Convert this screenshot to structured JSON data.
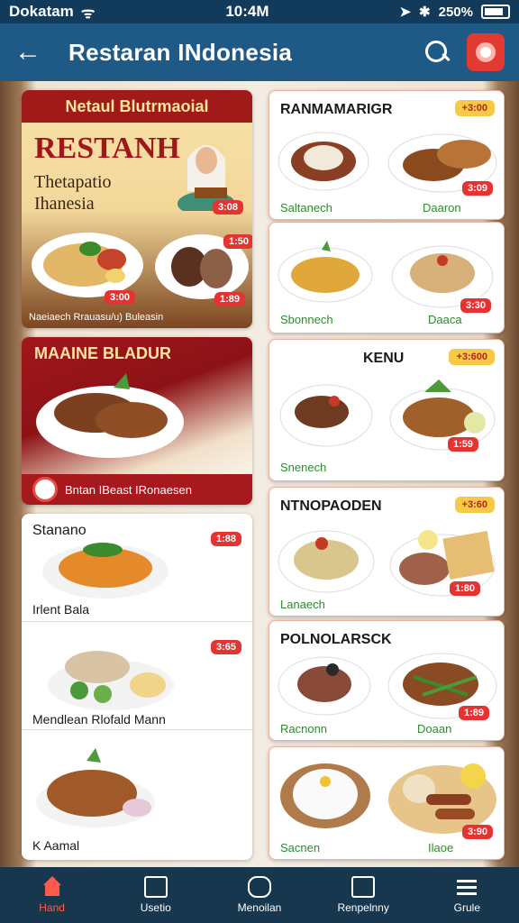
{
  "status": {
    "carrier": "Dokatam",
    "time": "10:4M",
    "battery": "250%"
  },
  "appbar": {
    "title": "Restaran INdonesia"
  },
  "left": {
    "promo1": {
      "header": "Netaul Blutrmaoial",
      "title": "RESTANH",
      "subtitle_line1": "Thetapatio",
      "subtitle_line2": "Ihanesia",
      "price1": "3:08",
      "price2": "3:00",
      "price3": "1:50",
      "price4": "1:89",
      "footer": "Naeiaech Rrauasu/u) Buleasin"
    },
    "promo2": {
      "header": "MAAINE BLADUR",
      "footer": "Bntan IBeast IRonaesen"
    },
    "list": [
      {
        "name": "Stanano",
        "price": "1:88",
        "sub": "Irlent Bala"
      },
      {
        "name": "",
        "price": "3:65",
        "sub": "Mendlean Rlofald Mann"
      },
      {
        "name": "",
        "price": "",
        "sub": "K Aamal"
      }
    ]
  },
  "right": {
    "cards": [
      {
        "title": "RANMAMARIGR",
        "promo": "+3:00",
        "left_label": "Saltanech",
        "right_label": "Daaron",
        "price": "3:09"
      },
      {
        "title": "",
        "promo": "",
        "left_label": "Sbonnech",
        "right_label": "Daaca",
        "price": "3:30"
      },
      {
        "title": "KENU",
        "promo": "+3:600",
        "left_label": "Snenech",
        "right_label": "",
        "price": "1:59"
      },
      {
        "title": "NTNOPAODEN",
        "promo": "+3:60",
        "left_label": "Lanaech",
        "right_label": "",
        "price": "1:80"
      },
      {
        "title": "POLNOLARSCK",
        "promo": "",
        "left_label": "Racnonn",
        "right_label": "Doaan",
        "price": "1:89"
      },
      {
        "title": "",
        "promo": "",
        "left_label": "Sacnen",
        "right_label": "Ilaoe",
        "price": "3:90"
      }
    ]
  },
  "nav": [
    {
      "label": "Hand",
      "icon": "home-icon",
      "active": true
    },
    {
      "label": "Usetio",
      "icon": "box-icon",
      "active": false
    },
    {
      "label": "Menoilan",
      "icon": "chat-icon",
      "active": false
    },
    {
      "label": "Renpelnny",
      "icon": "window-icon",
      "active": false
    },
    {
      "label": "Grule",
      "icon": "menu-icon",
      "active": false
    }
  ]
}
